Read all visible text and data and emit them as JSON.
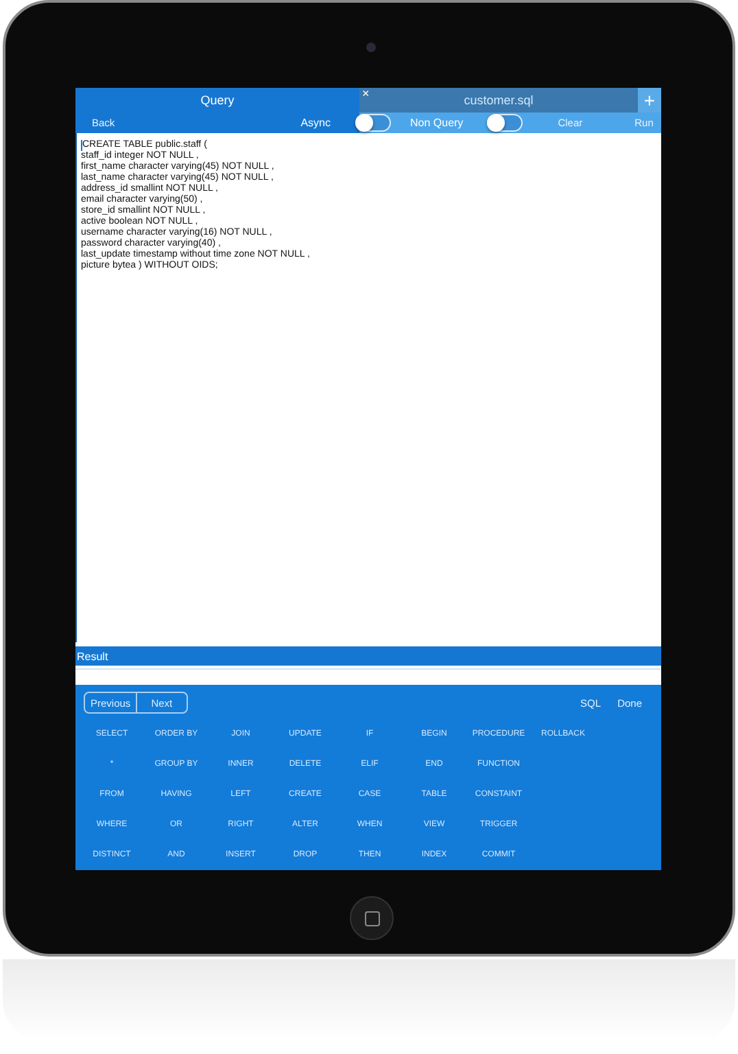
{
  "query_panel": {
    "title": "Query",
    "back": "Back",
    "async": {
      "label": "Async",
      "on": false
    }
  },
  "tab": {
    "close": "×",
    "label": "customer.sql",
    "selected": false
  },
  "add": "+",
  "non_query": {
    "label": "Non Query",
    "on": false
  },
  "clear": "Clear",
  "run": "Run",
  "editor": {
    "lines": [
      "CREATE TABLE public.staff (",
      "staff_id integer NOT NULL ,",
      "first_name character varying(45) NOT NULL ,",
      "last_name character varying(45) NOT NULL ,",
      "address_id smallint NOT NULL ,",
      "email character varying(50) ,",
      "store_id smallint NOT NULL ,",
      "active boolean NOT NULL ,",
      "username character varying(16) NOT NULL ,",
      "password character varying(40) ,",
      "last_update timestamp without time zone NOT NULL ,",
      "picture bytea ) WITHOUT OIDS;"
    ]
  },
  "result": {
    "label": "Result"
  },
  "keyboard": {
    "nav": [
      "Previous",
      "Next"
    ],
    "actions": [
      "SQL",
      "Done"
    ],
    "keys": [
      [
        "SELECT",
        "ORDER BY",
        "JOIN",
        "UPDATE",
        "IF",
        "BEGIN",
        "PROCEDURE",
        "ROLLBACK"
      ],
      [
        "*",
        "GROUP BY",
        "INNER",
        "DELETE",
        "ELIF",
        "END",
        "FUNCTION"
      ],
      [
        "FROM",
        "HAVING",
        "LEFT",
        "CREATE",
        "CASE",
        "TABLE",
        "CONSTAINT"
      ],
      [
        "WHERE",
        "OR",
        "RIGHT",
        "ALTER",
        "WHEN",
        "VIEW",
        "TRIGGER"
      ],
      [
        "DISTINCT",
        "AND",
        "INSERT",
        "DROP",
        "THEN",
        "INDEX",
        "COMMIT"
      ]
    ]
  }
}
